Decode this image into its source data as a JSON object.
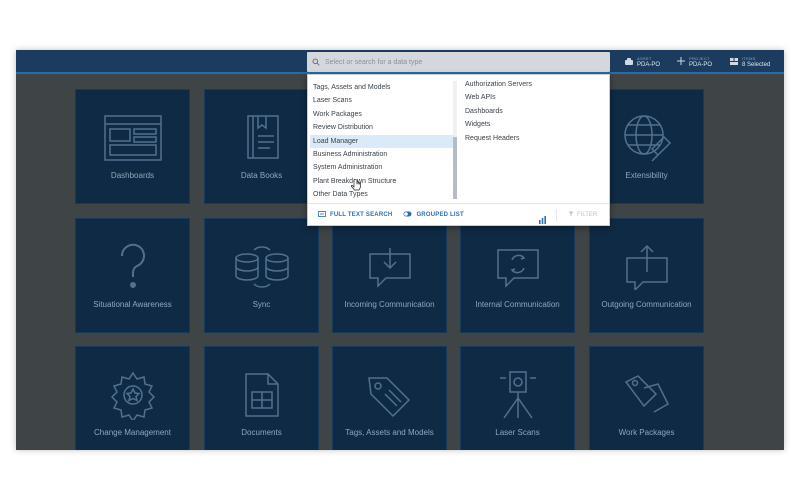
{
  "search": {
    "placeholder": "Select or search for a data type"
  },
  "topbar": {
    "items": [
      {
        "label": "ASSET",
        "value": "PDA-PO"
      },
      {
        "label": "PROJECT",
        "value": "PDA-PO"
      },
      {
        "label": "ITEMS",
        "value": "8 Selected"
      }
    ]
  },
  "tiles": [
    {
      "label": "Dashboards"
    },
    {
      "label": "Data Books"
    },
    {
      "label": "Extensibility"
    },
    {
      "label": "Situational Awareness"
    },
    {
      "label": "Sync"
    },
    {
      "label": "Incoming Communication"
    },
    {
      "label": "Internal Communication"
    },
    {
      "label": "Outgoing Communication"
    },
    {
      "label": "Change Management"
    },
    {
      "label": "Documents"
    },
    {
      "label": "Tags, Assets and Models"
    },
    {
      "label": "Laser Scans"
    },
    {
      "label": "Work Packages"
    }
  ],
  "dropdown": {
    "left_items": [
      "Tags, Assets and Models",
      "Laser Scans",
      "Work Packages",
      "Review Distribution",
      "Load Manager",
      "Business Administration",
      "System Administration",
      "Plant Breakdown Structure",
      "Other Data Types"
    ],
    "highlighted_index": 4,
    "right_items": [
      "Authorization Servers",
      "Web APIs",
      "Dashboards",
      "Widgets",
      "Request Headers"
    ],
    "footer": {
      "full_text_search": "FULL TEXT SEARCH",
      "grouped_list": "GROUPED LIST",
      "filter": "FILTER"
    }
  },
  "colors": {
    "topbar": "#1b3c5e",
    "tile": "#0f2a44",
    "tile_icon": "#52708f",
    "overlay": "#3f4447",
    "accent": "#2c6fb0",
    "highlight": "#dbeaf8"
  }
}
